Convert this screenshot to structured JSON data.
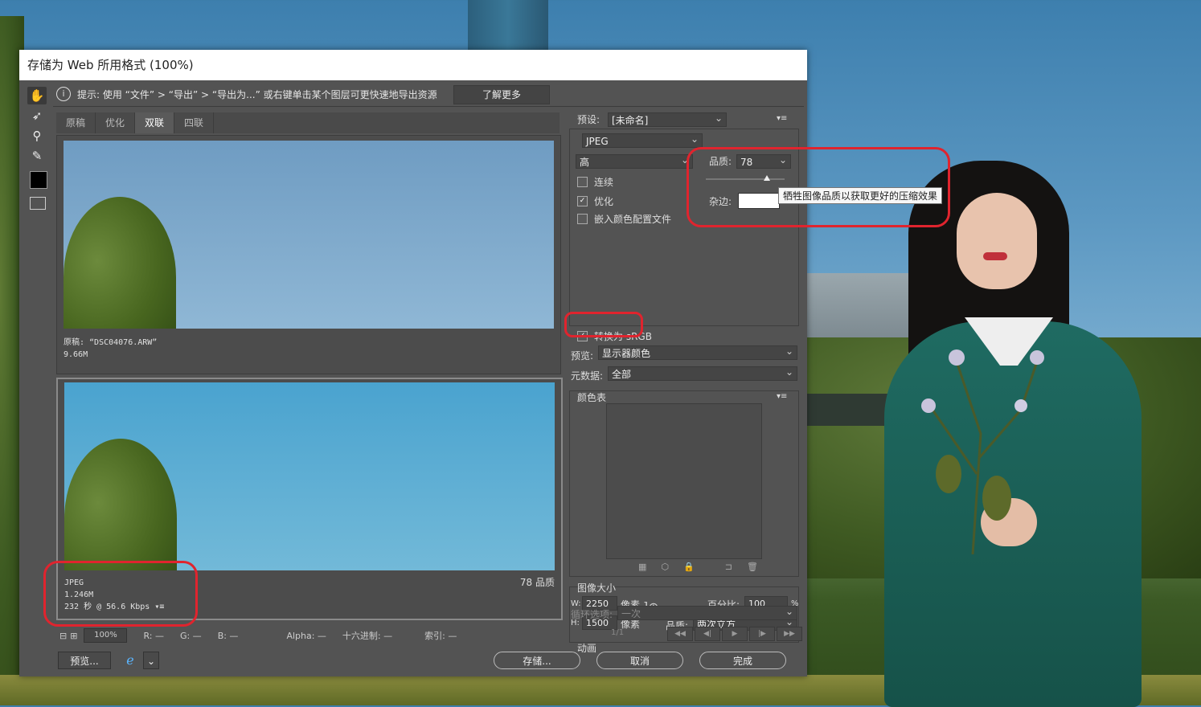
{
  "dialog": {
    "title": "存储为 Web 所用格式 (100%)",
    "hint": "提示: 使用 “文件” > “导出” > “导出为...” 或右键单击某个图层可更快速地导出资源",
    "learn_more": "了解更多"
  },
  "tabs": [
    "原稿",
    "优化",
    "双联",
    "四联"
  ],
  "original_pane": {
    "label": "原稿: “DSC04076.ARW”",
    "size": "9.66M"
  },
  "optimized_pane": {
    "format": "JPEG",
    "size": "1.246M",
    "speed": "232 秒 @ 56.6 Kbps",
    "quality": "78 品质"
  },
  "statusbar": {
    "zoom": "100%",
    "r": "R: —",
    "g": "G: —",
    "b": "B: —",
    "alpha": "Alpha: —",
    "hex": "十六进制: —",
    "index": "索引: —"
  },
  "buttons": {
    "preview": "预览...",
    "save": "存储...",
    "cancel": "取消",
    "done": "完成"
  },
  "settings": {
    "preset_label": "预设:",
    "preset_value": "[未命名]",
    "format": "JPEG",
    "compression": "高",
    "quality_label": "品质:",
    "quality_value": "78",
    "quality_fraction": 0.78,
    "progressive": "连续",
    "optimized": "优化",
    "embed_profile": "嵌入颜色配置文件",
    "matte_label": "杂边:",
    "tooltip": "牺牲图像品质以获取更好的压缩效果",
    "convert_srgb": "转换为 sRGB",
    "preview_label": "预览:",
    "preview_value": "显示器颜色",
    "metadata_label": "元数据:",
    "metadata_value": "全部",
    "color_table": "颜色表"
  },
  "image_size": {
    "title": "图像大小",
    "w_label": "W:",
    "w_value": "2250",
    "h_label": "H:",
    "h_value": "1500",
    "unit": "像素",
    "percent_label": "百分比:",
    "percent_value": "100",
    "percent_unit": "%",
    "quality_label": "品质:",
    "quality_value": "两次立方"
  },
  "animation": {
    "title": "动画",
    "loop_label": "循环选项:",
    "loop_value": "一次",
    "frame": "1/1"
  },
  "colors": {
    "accent_red": "#e0242e",
    "panel": "#535353"
  }
}
